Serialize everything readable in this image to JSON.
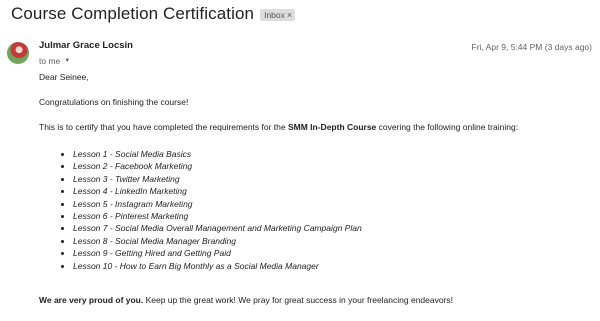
{
  "email": {
    "subject": "Course Completion Certification",
    "label": "Inbox",
    "label_close": "×",
    "sender": "Julmar Grace Locsin",
    "recipient": "to me",
    "date": "Fri, Apr 9, 5:44 PM (3 days ago)"
  },
  "body": {
    "greeting": "Dear Seinee,",
    "congrats": "Congratulations on finishing the course!",
    "certify_pre": "This is to certify that you have completed the requirements for the ",
    "certify_course": "SMM In-Depth Course",
    "certify_post": " covering the following online training:",
    "lessons": [
      "Lesson 1 - Social Media Basics",
      "Lesson 2 - Facebook Marketing",
      "Lesson 3 - Twitter Marketing",
      "Lesson 4 - LinkedIn Marketing",
      "Lesson 5 - Instagram Marketing",
      "Lesson 6 - Pinterest Marketing",
      "Lesson 7 - Social Media Overall Management and Marketing Campaign Plan",
      "Lesson 8 - Social Media Manager Branding",
      "Lesson 9 - Getting Hired and Getting Paid",
      "Lesson 10 - How to Earn Big Monthly as a Social Media Manager"
    ],
    "closing_bold": "We are very proud of you.",
    "closing_rest": " Keep up the great work! We pray for great success in your freelancing endeavors!"
  }
}
